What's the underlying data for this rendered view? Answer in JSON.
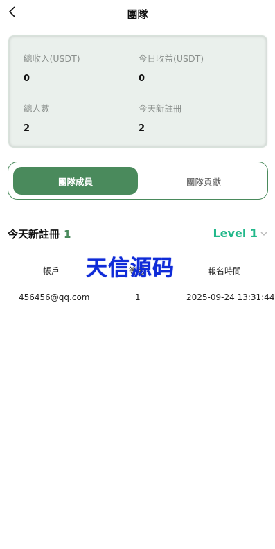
{
  "header": {
    "title": "團隊"
  },
  "stats": {
    "total_income_label": "總收入(USDT)",
    "total_income_value": "0",
    "today_income_label": "今日收益(USDT)",
    "today_income_value": "0",
    "total_people_label": "總人數",
    "total_people_value": "2",
    "today_registered_label": "今天新註冊",
    "today_registered_value": "2"
  },
  "tabs": [
    {
      "label": "團隊成員",
      "active": true
    },
    {
      "label": "團隊貢獻",
      "active": false
    }
  ],
  "today_section": {
    "label": "今天新註冊",
    "count": "1"
  },
  "level_select": {
    "value": "Level 1"
  },
  "table": {
    "columns": [
      "帳戶",
      "等級",
      "報名時間"
    ],
    "rows": [
      {
        "account": "456456@qq.com",
        "level": "1",
        "time": "2025-09-24 13:31:44"
      }
    ]
  },
  "watermark": {
    "text": "天信源码"
  },
  "colors": {
    "accent": "#4a8a5c",
    "level": "#21b88a",
    "card_bg": "#eaf0ec",
    "watermark": "#0f2bd8"
  }
}
